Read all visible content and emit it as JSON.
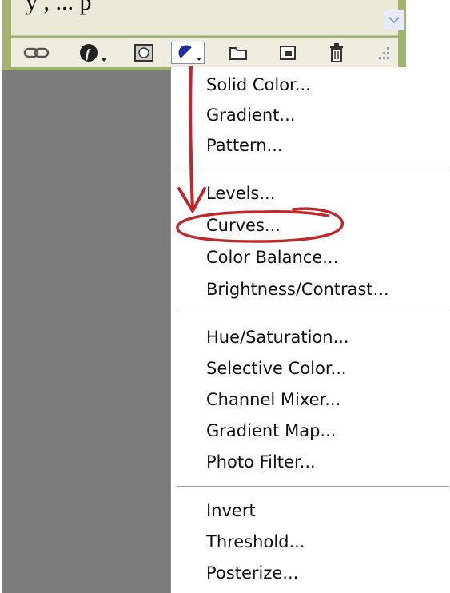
{
  "caption_fragment": "y                    , ... p",
  "toolbar": {
    "buttons": [
      {
        "name": "link-layers-button",
        "icon": "link-icon"
      },
      {
        "name": "layer-style-button",
        "icon": "fx-icon"
      },
      {
        "name": "add-mask-button",
        "icon": "mask-icon"
      },
      {
        "name": "new-adjustment-layer-button",
        "icon": "half-circle-icon"
      },
      {
        "name": "new-group-button",
        "icon": "folder-icon"
      },
      {
        "name": "new-layer-button",
        "icon": "new-layer-icon"
      },
      {
        "name": "delete-layer-button",
        "icon": "trash-icon"
      },
      {
        "name": "resize-grip",
        "icon": "resize-grip-icon"
      }
    ]
  },
  "menu": {
    "groups": [
      [
        "Solid Color...",
        "Gradient...",
        "Pattern..."
      ],
      [
        "Levels...",
        "Curves...",
        "Color Balance...",
        "Brightness/Contrast..."
      ],
      [
        "Hue/Saturation...",
        "Selective Color...",
        "Channel Mixer...",
        "Gradient Map...",
        "Photo Filter..."
      ],
      [
        "Invert",
        "Threshold...",
        "Posterize..."
      ]
    ]
  },
  "annotation": {
    "color": "#c0282c",
    "highlighted_item": "Curves..."
  },
  "colors": {
    "panel_green": "#9fb46e",
    "panel_gray": "#7c7c7c",
    "menu_bg": "#ffffff"
  }
}
